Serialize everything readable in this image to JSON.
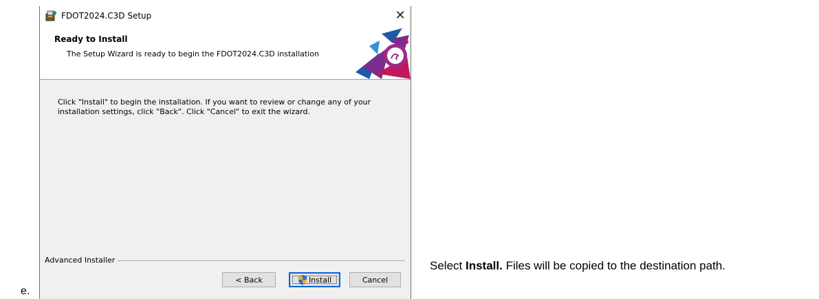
{
  "list_marker": "e.",
  "window": {
    "title": "FDOT2024.C3D Setup",
    "close_glyph": "✕"
  },
  "header": {
    "title": "Ready to Install",
    "subtitle": "The Setup Wizard is ready to begin the FDOT2024.C3D installation"
  },
  "body": {
    "text": "Click \"Install\" to begin the installation.  If you want to review or change any of your\ninstallation settings, click \"Back\".  Click \"Cancel\" to exit the wizard."
  },
  "footer": {
    "label": "Advanced Installer"
  },
  "buttons": {
    "back": "< Back",
    "install": "Install",
    "cancel": "Cancel"
  },
  "instruction": {
    "prefix": "Select ",
    "bold": "Install.",
    "suffix": " Files will be copied to the destination path."
  },
  "colors": {
    "focus_border": "#0a64d6",
    "window_bg": "#f0f0f0",
    "graphic_purple": "#7b2d8e",
    "graphic_magenta": "#c2185b",
    "graphic_blue": "#1e5aa8"
  }
}
